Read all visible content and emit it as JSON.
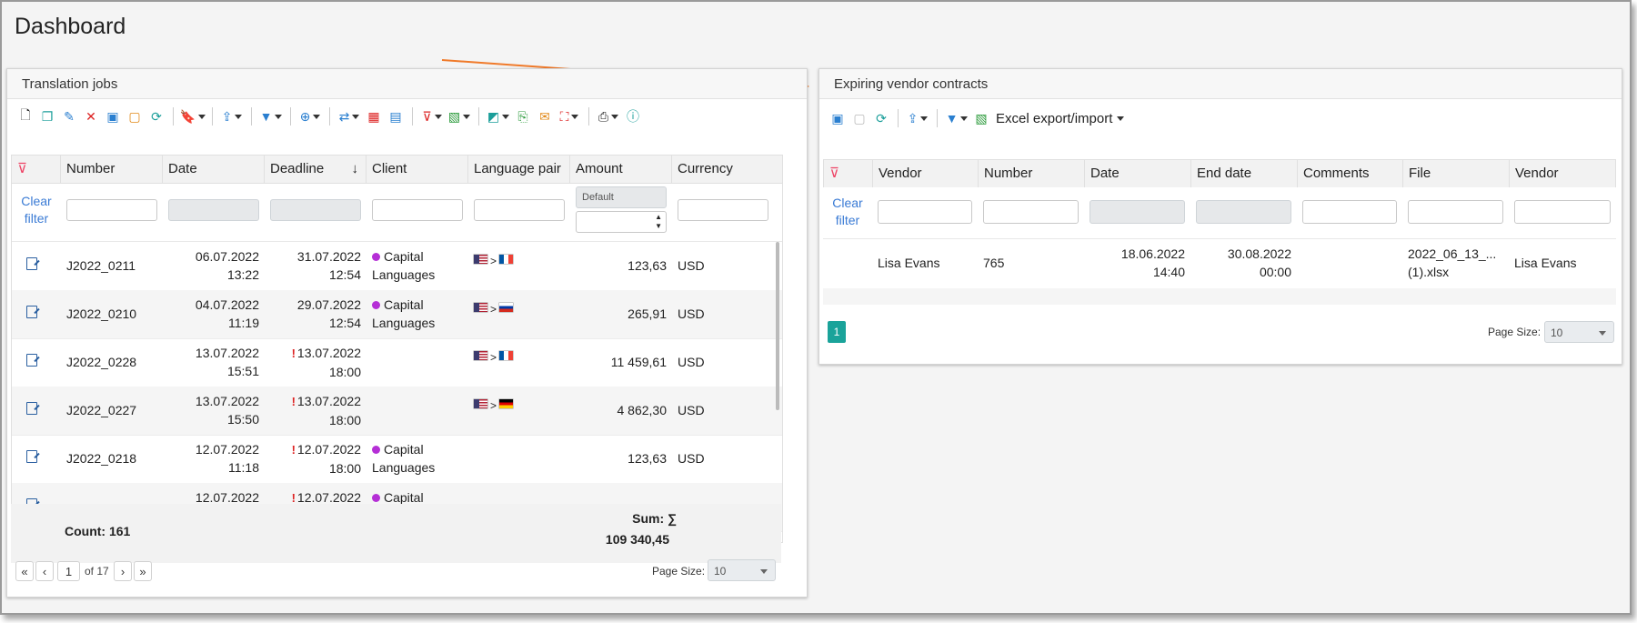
{
  "page": {
    "title": "Dashboard"
  },
  "jobs": {
    "title": "Translation jobs",
    "columns": [
      "Number",
      "Date",
      "Deadline",
      "Client",
      "Language pair",
      "Amount",
      "Currency"
    ],
    "sort_arrow": "↓",
    "clear_filter": [
      "Clear",
      "filter"
    ],
    "amount_filter_placeholder": "Default",
    "rows": [
      {
        "number": "J2022_0211",
        "date": [
          "06.07.2022",
          "13:22"
        ],
        "deadline": [
          "31.07.2022",
          "12:54"
        ],
        "overdue": false,
        "client": [
          "Capital",
          "Languages"
        ],
        "pair": [
          "us",
          "fr"
        ],
        "amount": "123,63",
        "currency": "USD"
      },
      {
        "number": "J2022_0210",
        "date": [
          "04.07.2022",
          "11:19"
        ],
        "deadline": [
          "29.07.2022",
          "12:54"
        ],
        "overdue": false,
        "client": [
          "Capital",
          "Languages"
        ],
        "pair": [
          "us",
          "ru"
        ],
        "amount": "265,91",
        "currency": "USD"
      },
      {
        "number": "J2022_0228",
        "date": [
          "13.07.2022",
          "15:51"
        ],
        "deadline": [
          "13.07.2022",
          "18:00"
        ],
        "overdue": true,
        "client": [
          "",
          ""
        ],
        "pair": [
          "us",
          "fr"
        ],
        "amount": "11 459,61",
        "currency": "USD"
      },
      {
        "number": "J2022_0227",
        "date": [
          "13.07.2022",
          "15:50"
        ],
        "deadline": [
          "13.07.2022",
          "18:00"
        ],
        "overdue": true,
        "client": [
          "",
          ""
        ],
        "pair": [
          "us",
          "de"
        ],
        "amount": "4 862,30",
        "currency": "USD"
      },
      {
        "number": "J2022_0218",
        "date": [
          "12.07.2022",
          "11:18"
        ],
        "deadline": [
          "12.07.2022",
          "18:00"
        ],
        "overdue": true,
        "client": [
          "Capital",
          "Languages"
        ],
        "pair": [],
        "amount": "123,63",
        "currency": "USD"
      },
      {
        "number": "",
        "date": [
          "12.07.2022",
          ""
        ],
        "deadline": [
          "12.07.2022",
          ""
        ],
        "overdue": true,
        "client": [
          "Capital",
          ""
        ],
        "pair": [],
        "amount": "",
        "currency": ""
      }
    ],
    "count_label": "Count: 161",
    "sum_label": "Sum: ∑",
    "sum_value": "109 340,45",
    "pager": {
      "page": "1",
      "of_label": "of 17",
      "page_size_label": "Page Size:",
      "page_size": "10"
    }
  },
  "contracts": {
    "title": "Expiring vendor contracts",
    "excel_label": "Excel export/import",
    "columns": [
      "Vendor",
      "Number",
      "Date",
      "End date",
      "Comments",
      "File",
      "Vendor"
    ],
    "clear_filter": [
      "Clear",
      "filter"
    ],
    "rows": [
      {
        "vendor": "Lisa Evans",
        "number": "765",
        "date": [
          "18.06.2022",
          "14:40"
        ],
        "end_date": [
          "30.08.2022",
          "00:00"
        ],
        "comments": "",
        "file": [
          "2022_06_13_...",
          "(1).xlsx"
        ],
        "vendor2": "Lisa Evans"
      }
    ],
    "pager": {
      "page": "1",
      "page_size_label": "Page Size:",
      "page_size": "10"
    }
  },
  "colors": {
    "accent_teal": "#1aa39a",
    "arrow": "#f07a2a",
    "client_dot": "#b52fd6",
    "overdue": "#dd2222"
  }
}
